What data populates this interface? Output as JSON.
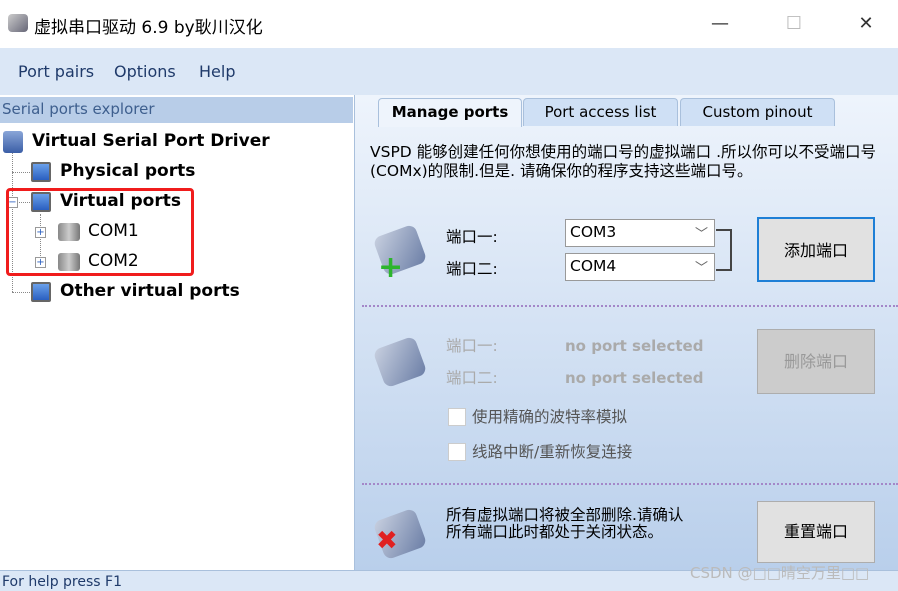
{
  "window": {
    "title": "虚拟串口驱动 6.9 by耿川汉化",
    "minimize": "—",
    "maximize": "☐",
    "close": "✕"
  },
  "menu": [
    {
      "label": "Port pairs"
    },
    {
      "label": "Options"
    },
    {
      "label": "Help"
    }
  ],
  "explorer": {
    "header": "Serial ports explorer",
    "root": "Virtual Serial Port Driver",
    "items": [
      "Physical ports",
      "Virtual ports",
      "Other virtual ports"
    ],
    "virtual_children": [
      "COM1",
      "COM2"
    ]
  },
  "tabs": [
    {
      "label": "Manage ports",
      "active": true
    },
    {
      "label": "Port access list"
    },
    {
      "label": "Custom pinout"
    }
  ],
  "manage": {
    "description": "VSPD 能够创建任何你想使用的端口号的虚拟端口 .所以你可以不受端口号(COMx)的限制.但是. 请确保你的程序支持这些端口号。",
    "add": {
      "port1_label": "端口一:",
      "port2_label": "端口二:",
      "port1_value": "COM3",
      "port2_value": "COM4",
      "button": "添加端口"
    },
    "delete": {
      "port1_label": "端口一:",
      "port2_label": "端口二:",
      "port1_value": "no port selected",
      "port2_value": "no port selected",
      "button": "删除端口",
      "checkbox1": "使用精确的波特率模拟",
      "checkbox2": "线路中断/重新恢复连接",
      "checkbox1_checked": false,
      "checkbox2_checked": false
    },
    "reset": {
      "text": "所有虚拟端口将被全部删除.请确认所有端口此时都处于关闭状态。",
      "button": "重置端口"
    }
  },
  "status": "For help press F1",
  "watermark": "CSDN @□□晴空万里□□"
}
